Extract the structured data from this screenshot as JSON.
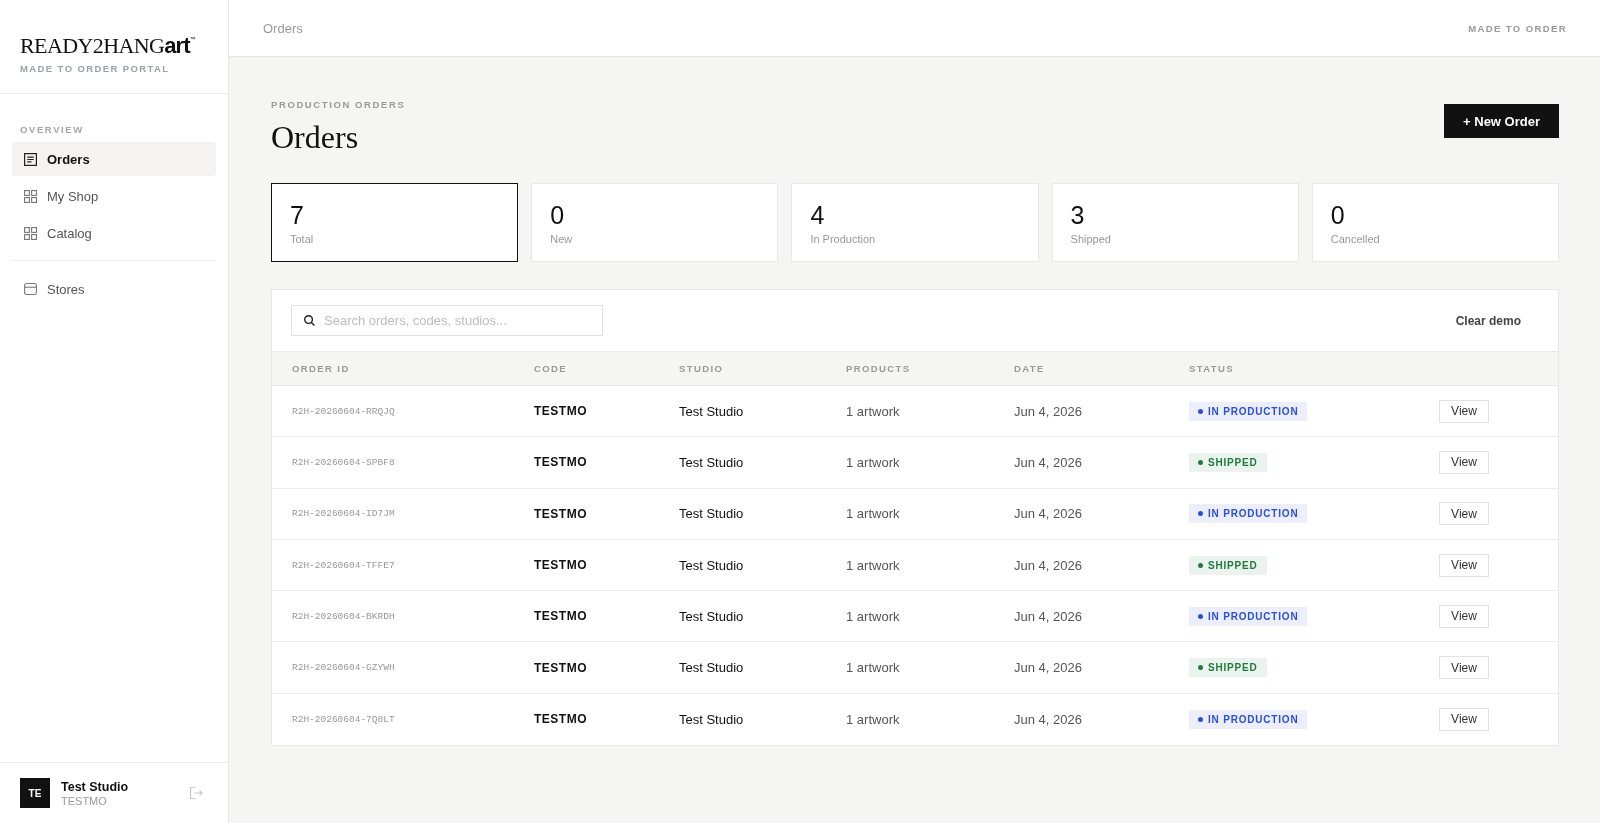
{
  "sidebar": {
    "logo": "READY2HANG**art**$^{™}$",
    "subtitle": "MADE TO ORDER PORTAL",
    "sections": [
      {
        "heading": "OVERVIEW",
        "items": [
          {
            "label": "Orders",
            "selected": true
          },
          {
            "label": "My Shop",
            "selected": false
          },
          {
            "label": "Catalog",
            "selected": false
          }
        ]
      },
      {
        "items": [
          {
            "label": "Stores",
            "selected": false
          }
        ]
      }
    ],
    "user": {
      "initials": "TE",
      "name": "Test Studio",
      "code": "TESTMO"
    }
  },
  "header": {
    "breadcrumb": "Orders",
    "tag": "MADE TO ORDER"
  },
  "page": {
    "eyebrow": "PRODUCTION ORDERS",
    "title": "Orders",
    "primary_button": "+ New Order"
  },
  "stats": [
    {
      "value": "7",
      "label": "Total",
      "selected": true
    },
    {
      "value": "0",
      "label": "New",
      "selected": false
    },
    {
      "value": "4",
      "label": "In Production",
      "selected": false
    },
    {
      "value": "3",
      "label": "Shipped",
      "selected": false
    },
    {
      "value": "0",
      "label": "Cancelled",
      "selected": false
    }
  ],
  "table": {
    "search": {
      "placeholder": "Search orders, codes, studios..."
    },
    "clear_button": "Clear demo",
    "columns": [
      "ORDER ID",
      "CODE",
      "STUDIO",
      "PRODUCTS",
      "DATE",
      "STATUS"
    ],
    "rows": [
      {
        "order_id": "R2H-20260604-RRQJQ",
        "code": "TESTMO",
        "studio": "Test Studio",
        "products": "1 artwork",
        "date": "Jun 4, 2026",
        "status": {
          "label": "IN PRODUCTION",
          "color": "#2b4fd8"
        },
        "action": "View"
      },
      {
        "order_id": "R2H-20260604-SPBF8",
        "code": "TESTMO",
        "studio": "Test Studio",
        "products": "1 artwork",
        "date": "Jun 4, 2026",
        "status": {
          "label": "SHIPPED",
          "color": "#1f7a3d"
        },
        "action": "View"
      },
      {
        "order_id": "R2H-20260604-ID7JM",
        "code": "TESTMO",
        "studio": "Test Studio",
        "products": "1 artwork",
        "date": "Jun 4, 2026",
        "status": {
          "label": "IN PRODUCTION",
          "color": "#2b4fd8"
        },
        "action": "View"
      },
      {
        "order_id": "R2H-20260604-TFFE7",
        "code": "TESTMO",
        "studio": "Test Studio",
        "products": "1 artwork",
        "date": "Jun 4, 2026",
        "status": {
          "label": "SHIPPED",
          "color": "#1f7a3d"
        },
        "action": "View"
      },
      {
        "order_id": "R2H-20260604-BKRDH",
        "code": "TESTMO",
        "studio": "Test Studio",
        "products": "1 artwork",
        "date": "Jun 4, 2026",
        "status": {
          "label": "IN PRODUCTION",
          "color": "#2b4fd8"
        },
        "action": "View"
      },
      {
        "order_id": "R2H-20260604-GZYWH",
        "code": "TESTMO",
        "studio": "Test Studio",
        "products": "1 artwork",
        "date": "Jun 4, 2026",
        "status": {
          "label": "SHIPPED",
          "color": "#1f7a3d"
        },
        "action": "View"
      },
      {
        "order_id": "R2H-20260604-7Q8LT",
        "code": "TESTMO",
        "studio": "Test Studio",
        "products": "1 artwork",
        "date": "Jun 4, 2026",
        "status": {
          "label": "IN PRODUCTION",
          "color": "#2b4fd8"
        },
        "action": "View"
      }
    ]
  }
}
